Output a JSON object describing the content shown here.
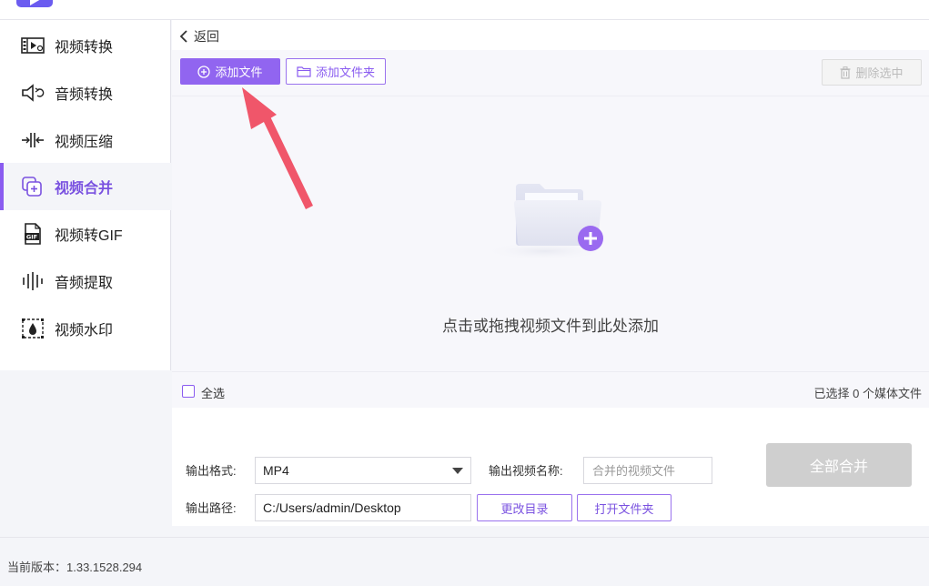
{
  "sidebar": {
    "items": [
      {
        "label": "视频转换",
        "icon": "video-convert-icon",
        "active": false
      },
      {
        "label": "音频转换",
        "icon": "audio-convert-icon",
        "active": false
      },
      {
        "label": "视频压缩",
        "icon": "video-compress-icon",
        "active": false
      },
      {
        "label": "视频合并",
        "icon": "video-merge-icon",
        "active": true
      },
      {
        "label": "视频转GIF",
        "icon": "gif-icon",
        "active": false
      },
      {
        "label": "音频提取",
        "icon": "audio-extract-icon",
        "active": false
      },
      {
        "label": "视频水印",
        "icon": "watermark-icon",
        "active": false
      }
    ]
  },
  "main": {
    "back_label": "返回",
    "toolbar": {
      "add_file": "添加文件",
      "add_folder": "添加文件夹",
      "delete_selected": "删除选中"
    },
    "dropzone": {
      "hint": "点击或拖拽视频文件到此处添加"
    },
    "selection": {
      "select_all": "全选",
      "selected_count": "已选择 0 个媒体文件"
    },
    "settings": {
      "format_label": "输出格式:",
      "format_value": "MP4",
      "name_label": "输出视频名称:",
      "name_placeholder": "合并的视频文件",
      "path_label": "输出路径:",
      "path_value": "C:/Users/admin/Desktop",
      "change_dir": "更改目录",
      "open_folder": "打开文件夹",
      "merge_all": "全部合并"
    }
  },
  "footer": {
    "version": "当前版本：1.33.1528.294"
  },
  "colors": {
    "accent": "#9165f0",
    "accent_text": "#7a52e0",
    "annotation_arrow": "#f0566a",
    "disabled": "#cfcfcf"
  }
}
